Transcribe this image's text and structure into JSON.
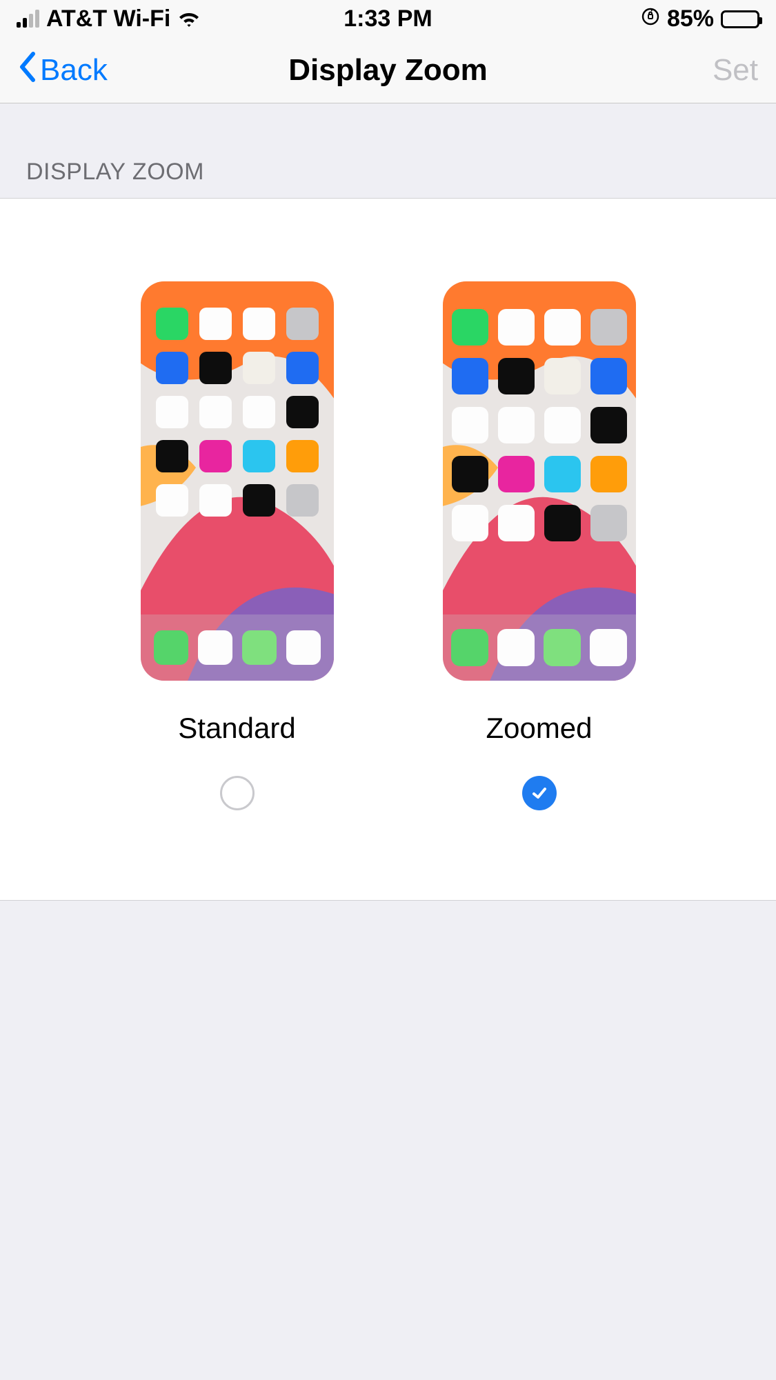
{
  "status": {
    "carrier": "AT&T Wi-Fi",
    "time": "1:33 PM",
    "battery_pct": "85%"
  },
  "nav": {
    "back_label": "Back",
    "title": "Display Zoom",
    "set_label": "Set"
  },
  "section": {
    "header": "DISPLAY ZOOM"
  },
  "options": {
    "standard": {
      "label": "Standard",
      "selected": false
    },
    "zoomed": {
      "label": "Zoomed",
      "selected": true
    }
  }
}
